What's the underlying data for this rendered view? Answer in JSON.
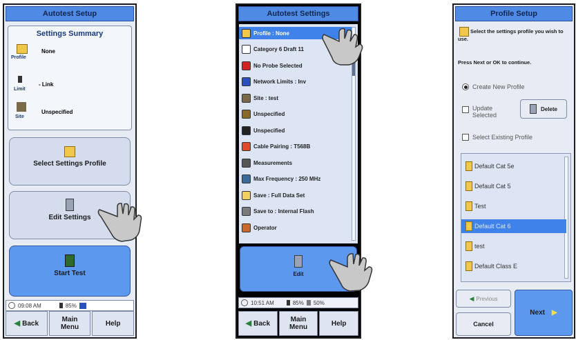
{
  "panel1": {
    "title": "Autotest Setup",
    "summary_title": "Settings Summary",
    "rows": [
      {
        "label": "Profile",
        "value": "None"
      },
      {
        "label": "Limit",
        "value": "- Link"
      },
      {
        "label": "Site",
        "value": "Unspecified"
      }
    ],
    "select_profile_label": "Select Settings Profile",
    "edit_settings_label": "Edit Settings",
    "start_test_label": "Start Test",
    "status_time": "09:08 AM",
    "status_battery": "85%",
    "back_label": "Back",
    "main_menu_label": "Main Menu",
    "help_label": "Help"
  },
  "panel2": {
    "title": "Autotest Settings",
    "items": [
      {
        "label": "Profile : None",
        "icon": "folder-icon",
        "color": "#f0c84a"
      },
      {
        "label": "Category 6 Draft 11",
        "icon": "document-icon",
        "color": "#ffffff"
      },
      {
        "label": "No Probe Selected",
        "icon": "x-icon",
        "color": "#d22222"
      },
      {
        "label": "Network Limits : Inv",
        "icon": "cable-icon",
        "color": "#2a4fbf"
      },
      {
        "label": "Site : test",
        "icon": "building-icon",
        "color": "#7a6a4a"
      },
      {
        "label": "Unspecified",
        "icon": "connector-icon",
        "color": "#8a6a2a"
      },
      {
        "label": "Unspecified",
        "icon": "jack-icon",
        "color": "#222222"
      },
      {
        "label": "Cable Pairing : T568B",
        "icon": "pairing-icon",
        "color": "#e04a2a"
      },
      {
        "label": "Measurements",
        "icon": "probe-icon",
        "color": "#555555"
      },
      {
        "label": "Max Frequency : 250 MHz",
        "icon": "monitor-icon",
        "color": "#3a6a9a"
      },
      {
        "label": "Save : Full Data Set",
        "icon": "save-icon",
        "color": "#f0d060"
      },
      {
        "label": "Save to : Internal Flash",
        "icon": "flash-icon",
        "color": "#7a7a7a"
      },
      {
        "label": "Operator",
        "icon": "operator-icon",
        "color": "#c86a2a"
      }
    ],
    "edit_label": "Edit",
    "status_time": "10:51 AM",
    "status_battery": "85%",
    "status_memory": "50%",
    "back_label": "Back",
    "main_menu_label": "Main Menu",
    "help_label": "Help"
  },
  "panel3": {
    "title": "Profile Setup",
    "instruction": "Select the settings profile you wish to use.",
    "instruction2": "Press Next or OK to continue.",
    "options": [
      {
        "label": "Create New Profile",
        "selected": true
      },
      {
        "label": "Update Selected",
        "selected": false
      },
      {
        "label": "Select Existing Profile",
        "selected": false
      }
    ],
    "delete_label": "Delete",
    "profiles": [
      "Default Cat 5e",
      "Default Cat 5",
      "Test",
      "Default Cat 6",
      "test",
      "Default Class E"
    ],
    "selected_profile": "Default Cat 6",
    "previous_label": "Previous",
    "next_label": "Next",
    "cancel_label": "Cancel"
  },
  "colors": {
    "title_blue": "#4f8be4",
    "button_blue": "#5c98ee",
    "panel_bg": "#e7ecf4",
    "selected_blue": "#3f82ea"
  }
}
